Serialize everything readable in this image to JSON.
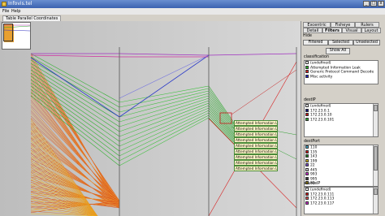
{
  "window": {
    "title": "Infovis.tel",
    "min": "_",
    "max": "□",
    "close": "x"
  },
  "menu": {
    "file": "File",
    "help": "Help"
  },
  "main_tab": "Table Parallel Coordinates",
  "tooltip_items": [
    "Attempted Information Leak",
    "Attempted Information Leak",
    "Attempted Information Leak",
    "Attempted Information Leak",
    "Attempted Information Leak",
    "Attempted Information Leak",
    "Attempted Information Leak",
    "Attempted Information Leak",
    "Attempted Information Leak"
  ],
  "panel": {
    "tabs_row1": [
      "Excentric",
      "Fisheye",
      "Rulers"
    ],
    "tabs_row2": [
      "Detail",
      "Filters",
      "Visual",
      "Layout"
    ],
    "hide_label": "Hide",
    "filter_buttons": [
      "Filtered",
      "Selected",
      "Unselected"
    ],
    "show_all": "Show All",
    "classification": {
      "label": "classification",
      "items": [
        {
          "text": "(undefined)",
          "color": "#ffffff"
        },
        {
          "text": "Attempted Information Leak",
          "color": "#22b822"
        },
        {
          "text": "Generic Protocol Command Decode",
          "color": "#d82020"
        },
        {
          "text": "Misc activity",
          "color": "#2020c8"
        }
      ]
    },
    "destIP": {
      "label": "destIP",
      "items": [
        {
          "text": "(undefined)",
          "color": "#ffffff"
        },
        {
          "text": "172.23.0.1",
          "color": "#101080"
        },
        {
          "text": "172.23.0.10",
          "color": "#c81818"
        },
        {
          "text": "172.23.0.101",
          "color": "#30b030"
        }
      ]
    },
    "destPort": {
      "label": "destPort",
      "items": [
        {
          "text": "110",
          "color": "#40a8c8"
        },
        {
          "text": "135",
          "color": "#c81818"
        },
        {
          "text": "143",
          "color": "#208020"
        },
        {
          "text": "199",
          "color": "#c8a818"
        },
        {
          "text": "22",
          "color": "#7848c8"
        },
        {
          "text": "445",
          "color": "#c8c8c8"
        },
        {
          "text": "993",
          "color": "#c828c8"
        },
        {
          "text": "995",
          "color": "#3a3a3a"
        },
        {
          "text": "80",
          "color": "#e0c020"
        }
      ]
    },
    "sourceIP": {
      "label": "sourceIP",
      "items": [
        {
          "text": "(undefined)",
          "color": "#ffffff"
        },
        {
          "text": "172.23.0.111",
          "color": "#c81818"
        },
        {
          "text": "172.23.0.113",
          "color": "#d85050"
        },
        {
          "text": "172.23.0.117",
          "color": "#c828c8"
        }
      ]
    }
  }
}
